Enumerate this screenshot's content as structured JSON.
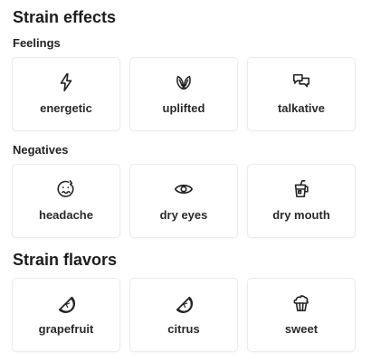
{
  "effects": {
    "title": "Strain effects",
    "feelings": {
      "heading": "Feelings",
      "items": [
        {
          "label": "energetic",
          "icon": "lightning-bolt-icon"
        },
        {
          "label": "uplifted",
          "icon": "leaves-icon"
        },
        {
          "label": "talkative",
          "icon": "chat-bubbles-icon"
        }
      ]
    },
    "negatives": {
      "heading": "Negatives",
      "items": [
        {
          "label": "headache",
          "icon": "headache-face-icon"
        },
        {
          "label": "dry eyes",
          "icon": "eye-icon"
        },
        {
          "label": "dry mouth",
          "icon": "drink-cup-icon"
        }
      ]
    }
  },
  "flavors": {
    "title": "Strain flavors",
    "items": [
      {
        "label": "grapefruit",
        "icon": "grapefruit-slice-icon"
      },
      {
        "label": "citrus",
        "icon": "citrus-slice-icon"
      },
      {
        "label": "sweet",
        "icon": "cupcake-icon"
      }
    ]
  },
  "colors": {
    "text": "#1d1d1d",
    "card_border": "#ececec",
    "background": "#ffffff"
  }
}
